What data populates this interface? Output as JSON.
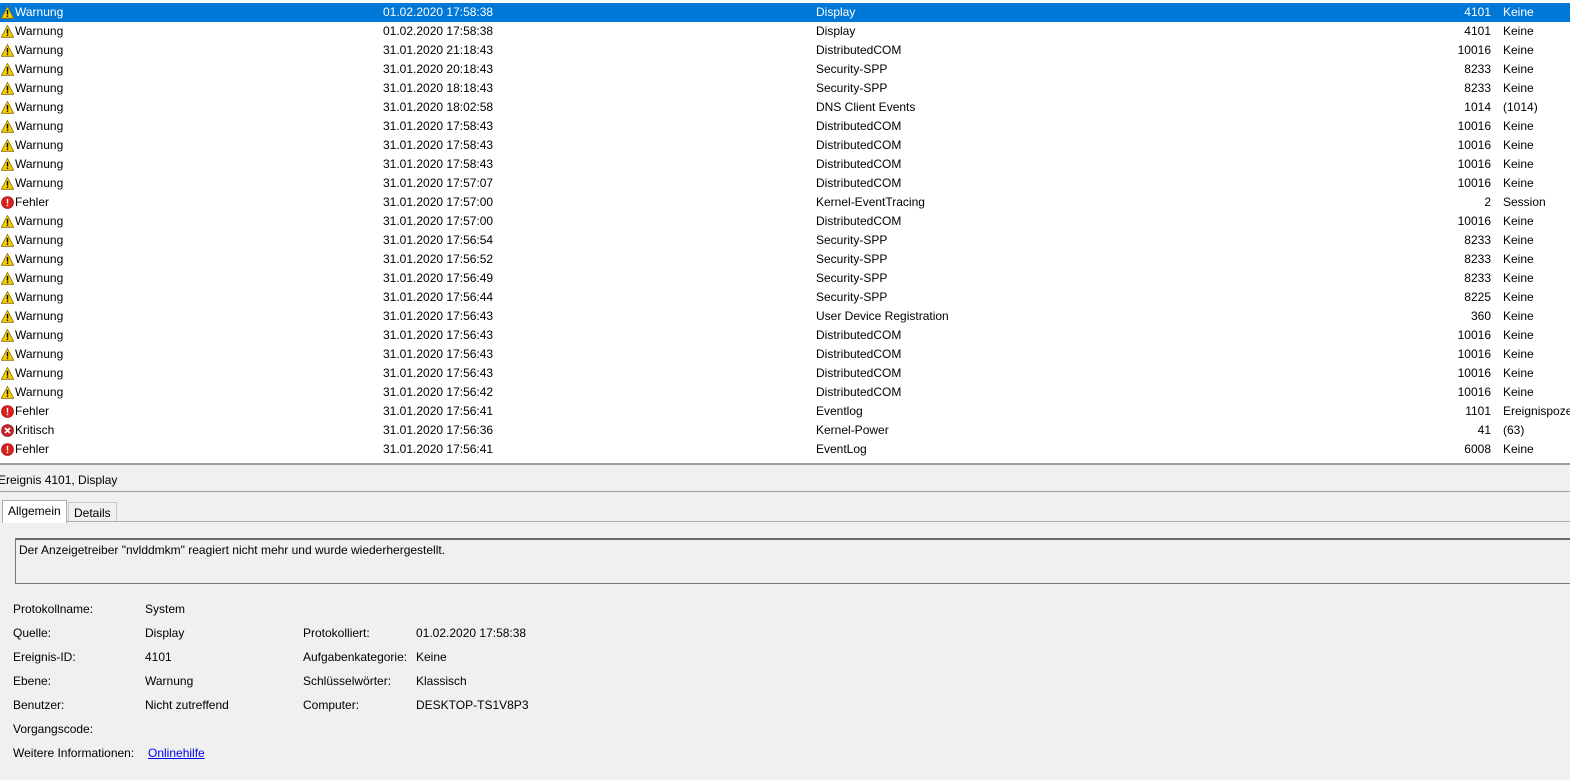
{
  "events": [
    {
      "level": "Warnung",
      "date": "01.02.2020 17:58:38",
      "source": "Display",
      "id": "4101",
      "category": "Keine",
      "type": "warning",
      "selected": true
    },
    {
      "level": "Warnung",
      "date": "01.02.2020 17:58:38",
      "source": "Display",
      "id": "4101",
      "category": "Keine",
      "type": "warning"
    },
    {
      "level": "Warnung",
      "date": "31.01.2020 21:18:43",
      "source": "DistributedCOM",
      "id": "10016",
      "category": "Keine",
      "type": "warning"
    },
    {
      "level": "Warnung",
      "date": "31.01.2020 20:18:43",
      "source": "Security-SPP",
      "id": "8233",
      "category": "Keine",
      "type": "warning"
    },
    {
      "level": "Warnung",
      "date": "31.01.2020 18:18:43",
      "source": "Security-SPP",
      "id": "8233",
      "category": "Keine",
      "type": "warning"
    },
    {
      "level": "Warnung",
      "date": "31.01.2020 18:02:58",
      "source": "DNS Client Events",
      "id": "1014",
      "category": "(1014)",
      "type": "warning"
    },
    {
      "level": "Warnung",
      "date": "31.01.2020 17:58:43",
      "source": "DistributedCOM",
      "id": "10016",
      "category": "Keine",
      "type": "warning"
    },
    {
      "level": "Warnung",
      "date": "31.01.2020 17:58:43",
      "source": "DistributedCOM",
      "id": "10016",
      "category": "Keine",
      "type": "warning"
    },
    {
      "level": "Warnung",
      "date": "31.01.2020 17:58:43",
      "source": "DistributedCOM",
      "id": "10016",
      "category": "Keine",
      "type": "warning"
    },
    {
      "level": "Warnung",
      "date": "31.01.2020 17:57:07",
      "source": "DistributedCOM",
      "id": "10016",
      "category": "Keine",
      "type": "warning"
    },
    {
      "level": "Fehler",
      "date": "31.01.2020 17:57:00",
      "source": "Kernel-EventTracing",
      "id": "2",
      "category": "Session",
      "type": "error"
    },
    {
      "level": "Warnung",
      "date": "31.01.2020 17:57:00",
      "source": "DistributedCOM",
      "id": "10016",
      "category": "Keine",
      "type": "warning"
    },
    {
      "level": "Warnung",
      "date": "31.01.2020 17:56:54",
      "source": "Security-SPP",
      "id": "8233",
      "category": "Keine",
      "type": "warning"
    },
    {
      "level": "Warnung",
      "date": "31.01.2020 17:56:52",
      "source": "Security-SPP",
      "id": "8233",
      "category": "Keine",
      "type": "warning"
    },
    {
      "level": "Warnung",
      "date": "31.01.2020 17:56:49",
      "source": "Security-SPP",
      "id": "8233",
      "category": "Keine",
      "type": "warning"
    },
    {
      "level": "Warnung",
      "date": "31.01.2020 17:56:44",
      "source": "Security-SPP",
      "id": "8225",
      "category": "Keine",
      "type": "warning"
    },
    {
      "level": "Warnung",
      "date": "31.01.2020 17:56:43",
      "source": "User Device Registration",
      "id": "360",
      "category": "Keine",
      "type": "warning"
    },
    {
      "level": "Warnung",
      "date": "31.01.2020 17:56:43",
      "source": "DistributedCOM",
      "id": "10016",
      "category": "Keine",
      "type": "warning"
    },
    {
      "level": "Warnung",
      "date": "31.01.2020 17:56:43",
      "source": "DistributedCOM",
      "id": "10016",
      "category": "Keine",
      "type": "warning"
    },
    {
      "level": "Warnung",
      "date": "31.01.2020 17:56:43",
      "source": "DistributedCOM",
      "id": "10016",
      "category": "Keine",
      "type": "warning"
    },
    {
      "level": "Warnung",
      "date": "31.01.2020 17:56:42",
      "source": "DistributedCOM",
      "id": "10016",
      "category": "Keine",
      "type": "warning"
    },
    {
      "level": "Fehler",
      "date": "31.01.2020 17:56:41",
      "source": "Eventlog",
      "id": "1101",
      "category": "Ereignispoze",
      "type": "error"
    },
    {
      "level": "Kritisch",
      "date": "31.01.2020 17:56:36",
      "source": "Kernel-Power",
      "id": "41",
      "category": "(63)",
      "type": "critical"
    },
    {
      "level": "Fehler",
      "date": "31.01.2020 17:56:41",
      "source": "EventLog",
      "id": "6008",
      "category": "Keine",
      "type": "error"
    }
  ],
  "icons": {
    "warning": "warning-icon",
    "error": "error-icon",
    "critical": "critical-icon"
  },
  "colors": {
    "selection": "#0078d7",
    "warning": "#f5d000",
    "error": "#d9201f",
    "critical": "#c8242b",
    "link": "#0000ee"
  },
  "detail": {
    "header": "Ereignis 4101, Display",
    "tabs": {
      "general": "Allgemein",
      "details": "Details"
    },
    "description": "Der Anzeigetreiber \"nvlddmkm\" reagiert nicht mehr und wurde wiederhergestellt.",
    "labels": {
      "log_name": "Protokollname:",
      "source": "Quelle:",
      "event_id": "Ereignis-ID:",
      "level": "Ebene:",
      "user": "Benutzer:",
      "opcode": "Vorgangscode:",
      "more_info": "Weitere Informationen:",
      "logged": "Protokolliert:",
      "task_category": "Aufgabenkategorie:",
      "keywords": "Schlüsselwörter:",
      "computer": "Computer:"
    },
    "values": {
      "log_name": "System",
      "source": "Display",
      "event_id": "4101",
      "level": "Warnung",
      "user": "Nicht zutreffend",
      "opcode": "",
      "more_info_link": "Onlinehilfe",
      "logged": "01.02.2020 17:58:38",
      "task_category": "Keine",
      "keywords": "Klassisch",
      "computer": "DESKTOP-TS1V8P3"
    }
  }
}
